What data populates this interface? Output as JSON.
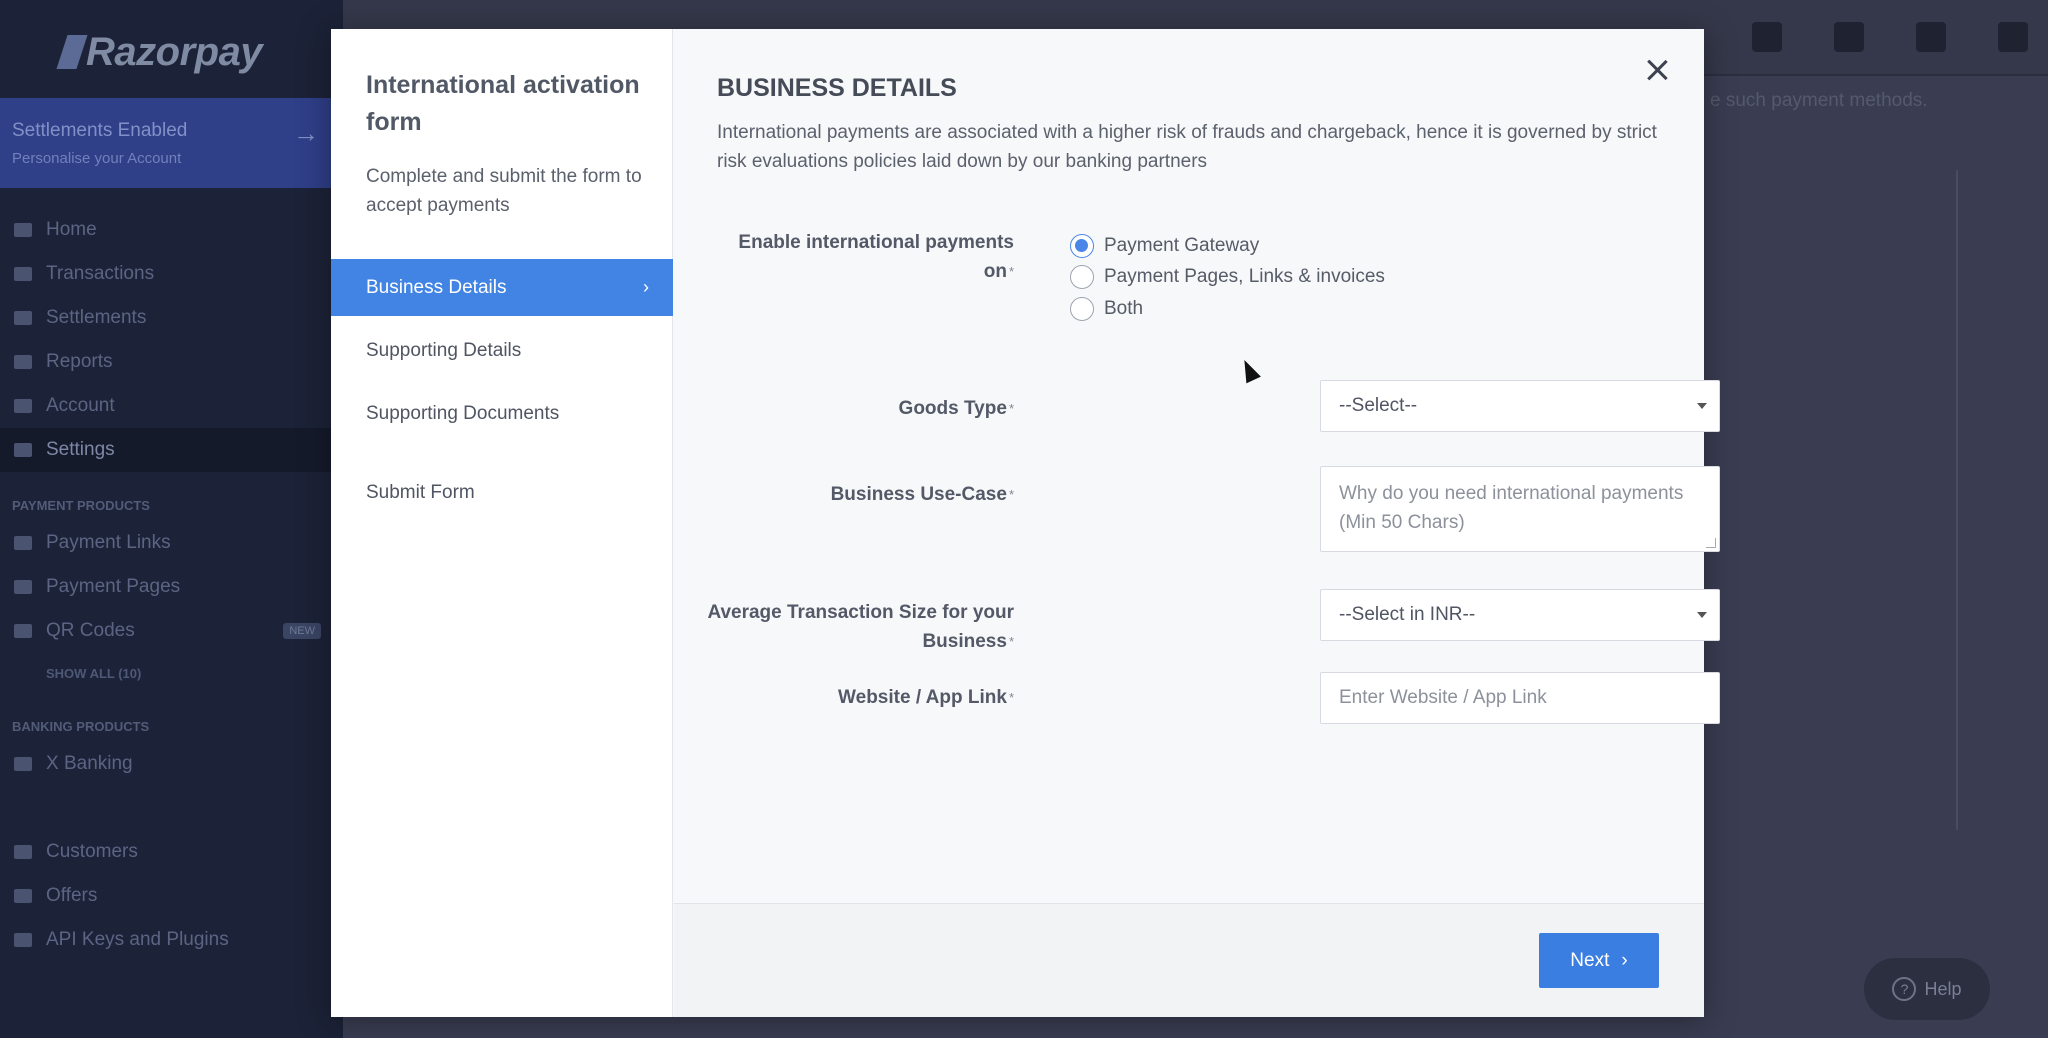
{
  "background": {
    "logo": "Razorpay",
    "promo": {
      "title": "Settlements Enabled",
      "subtitle": "Personalise your Account"
    },
    "nav": [
      "Home",
      "Transactions",
      "Settlements",
      "Reports",
      "Account",
      "Settings"
    ],
    "payment_products_title": "PAYMENT PRODUCTS",
    "payment_products": [
      "Payment Links",
      "Payment Pages",
      "QR Codes"
    ],
    "new_badge": "NEW",
    "show_all": "SHOW ALL (10)",
    "banking_products_title": "BANKING PRODUCTS",
    "banking_products": [
      "X Banking"
    ],
    "more_nav": [
      "Customers",
      "Offers",
      "API Keys and Plugins"
    ],
    "notice_text": "e such payment methods.",
    "help_label": "Help"
  },
  "modal": {
    "title": "International activation form",
    "subtitle": "Complete and submit the form to accept payments",
    "steps": [
      "Business Details",
      "Supporting Details",
      "Supporting Documents"
    ],
    "submit_step": "Submit Form",
    "section_title": "BUSINESS DETAILS",
    "section_desc": "International payments are associated with a higher risk of frauds and chargeback, hence it is governed by strict risk evaluations policies laid down by our banking partners",
    "fields": {
      "enable_on": {
        "label": "Enable international payments on",
        "options": [
          "Payment Gateway",
          "Payment Pages, Links & invoices",
          "Both"
        ],
        "selected": "Payment Gateway"
      },
      "goods_type": {
        "label": "Goods Type",
        "value": "--Select--"
      },
      "use_case": {
        "label": "Business Use-Case",
        "placeholder": "Why do you need international payments (Min 50 Chars)"
      },
      "avg_txn": {
        "label": "Average Transaction Size for your Business",
        "value": "--Select in INR--"
      },
      "website": {
        "label": "Website / App Link",
        "placeholder": "Enter Website / App Link"
      }
    },
    "required_mark": "*",
    "next_label": "Next"
  },
  "colors": {
    "accent": "#4184e4",
    "sidebar": "#1c2237"
  }
}
